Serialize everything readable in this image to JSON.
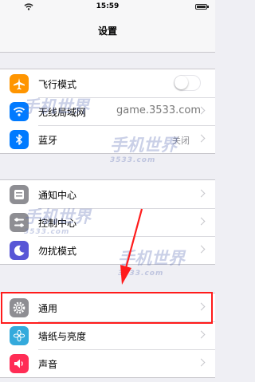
{
  "status_bar": {
    "time": "15:59"
  },
  "header": {
    "title": "设置"
  },
  "groups": [
    {
      "items": [
        {
          "name": "airplane",
          "label": "飞行模式",
          "icon": "airplane-icon",
          "icon_bg": "#ff9500",
          "toggle": false
        },
        {
          "name": "wlan",
          "label": "无线局域网",
          "icon": "wifi-icon",
          "icon_bg": "#007aff"
        },
        {
          "name": "bluetooth",
          "label": "蓝牙",
          "icon": "bluetooth-icon",
          "icon_bg": "#007aff",
          "value": "关闭"
        }
      ]
    },
    {
      "items": [
        {
          "name": "notifications",
          "label": "通知中心",
          "icon": "notifications-icon",
          "icon_bg": "#8e8e93"
        },
        {
          "name": "control-center",
          "label": "控制中心",
          "icon": "control-center-icon",
          "icon_bg": "#8e8e93"
        },
        {
          "name": "do-not-disturb",
          "label": "勿扰模式",
          "icon": "moon-icon",
          "icon_bg": "#5856d6"
        }
      ]
    },
    {
      "items": [
        {
          "name": "general",
          "label": "通用",
          "icon": "gear-icon",
          "icon_bg": "#8e8e93"
        },
        {
          "name": "wallpaper",
          "label": "墙纸与亮度",
          "icon": "flower-icon",
          "icon_bg": "#34aadc"
        },
        {
          "name": "sounds",
          "label": "声音",
          "icon": "speaker-icon",
          "icon_bg": "#ff2d55"
        }
      ]
    }
  ],
  "watermark": {
    "text": "手机世界",
    "sub": "3533.com",
    "site": "game.3533.com"
  },
  "annotation": {
    "color": "#ff1b1b"
  }
}
